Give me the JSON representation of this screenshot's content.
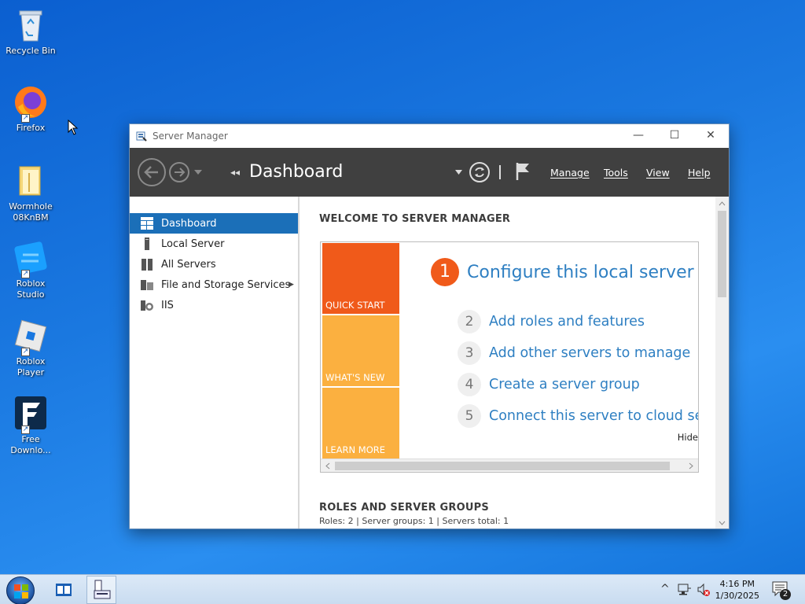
{
  "desktop": {
    "icons": [
      {
        "label": "Recycle Bin"
      },
      {
        "label": "Firefox"
      },
      {
        "label": "Wormhole 08KnBM"
      },
      {
        "label": "Roblox Studio"
      },
      {
        "label": "Roblox Player"
      },
      {
        "label": "Free Downlo..."
      }
    ]
  },
  "window": {
    "title": "Server Manager",
    "controls": {
      "minimize": "—",
      "maximize": "☐",
      "close": "✕"
    },
    "toolbar": {
      "breadcrumb_arrows": "◂◂",
      "title": "Dashboard",
      "menus": [
        "Manage",
        "Tools",
        "View",
        "Help"
      ]
    },
    "sidebar": {
      "items": [
        {
          "label": "Dashboard"
        },
        {
          "label": "Local Server"
        },
        {
          "label": "All Servers"
        },
        {
          "label": "File and Storage Services"
        },
        {
          "label": "IIS"
        }
      ],
      "expand_glyph": "▶"
    },
    "main": {
      "welcome_heading": "WELCOME TO SERVER MANAGER",
      "tiles": [
        {
          "label": "QUICK START",
          "color": "#f05a1a"
        },
        {
          "label": "WHAT'S NEW",
          "color": "#fbb040"
        },
        {
          "label": "LEARN MORE",
          "color": "#fbb040"
        }
      ],
      "primary_step": {
        "num": "1",
        "text": "Configure this local server"
      },
      "steps": [
        {
          "num": "2",
          "text": "Add roles and features"
        },
        {
          "num": "3",
          "text": "Add other servers to manage"
        },
        {
          "num": "4",
          "text": "Create a server group"
        },
        {
          "num": "5",
          "text": "Connect this server to cloud servic"
        }
      ],
      "hide_label": "Hide",
      "roles_heading": "ROLES AND SERVER GROUPS",
      "roles_summary": "Roles: 2   |   Server groups: 1   |   Servers total: 1"
    }
  },
  "taskbar": {
    "time": "4:16 PM",
    "date": "1/30/2025",
    "notification_count": "2",
    "tray_chevron": "^"
  },
  "colors": {
    "accent": "#1b6fb8",
    "toolbar": "#404040",
    "quick_start": "#f05a1a",
    "tile_secondary": "#fbb040",
    "link": "#2e7fc2"
  }
}
